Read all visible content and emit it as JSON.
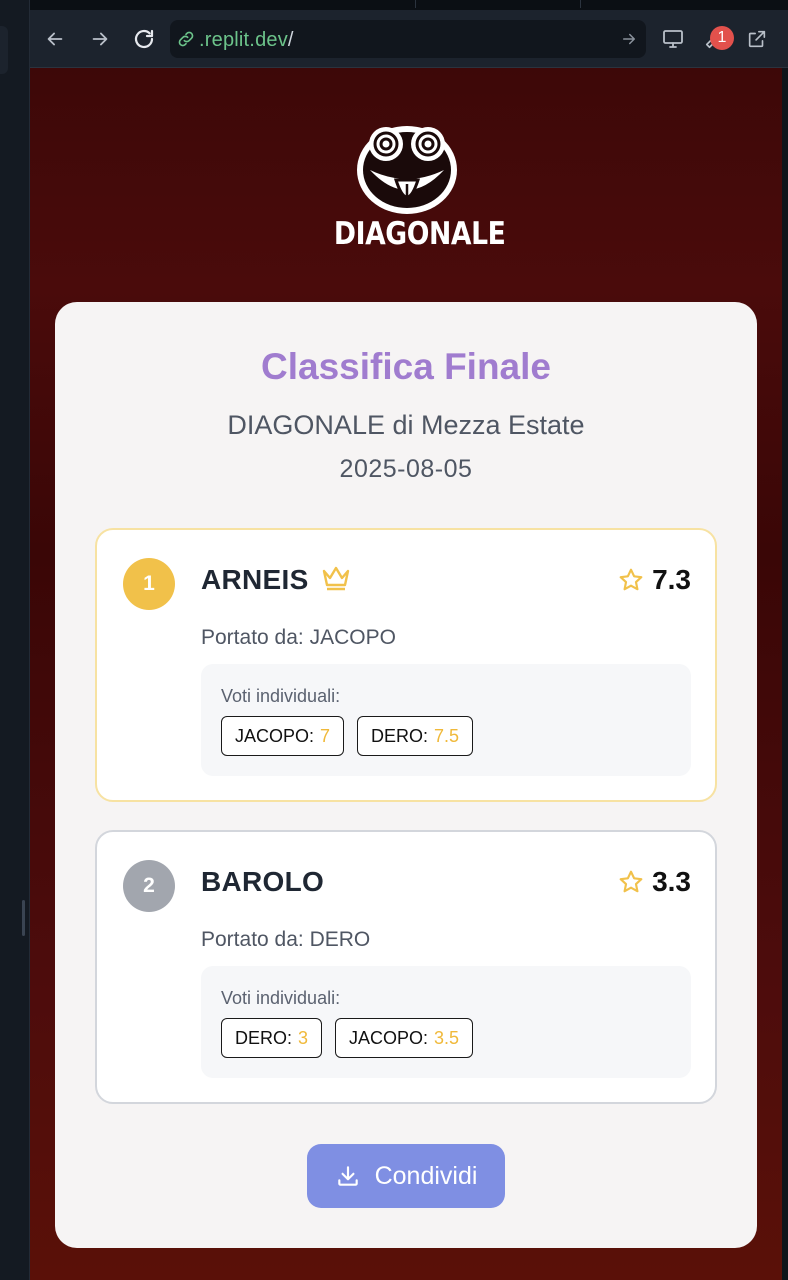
{
  "browser": {
    "url_host": ".replit.dev",
    "url_path": "/",
    "notification_count": "1"
  },
  "brand": {
    "name": "DIAGONALE"
  },
  "results": {
    "title": "Classifica Finale",
    "event_name": "DIAGONALE di Mezza Estate",
    "date": "2025-08-05",
    "votes_label": "Voti individuali:",
    "brought_prefix": "Portato da:",
    "ranking": [
      {
        "position": "1",
        "wine": "ARNEIS",
        "score": "7.3",
        "brought_by": "JACOPO",
        "votes": [
          {
            "name": "JACOPO:",
            "value": "7"
          },
          {
            "name": "DERO:",
            "value": "7.5"
          }
        ]
      },
      {
        "position": "2",
        "wine": "BAROLO",
        "score": "3.3",
        "brought_by": "DERO",
        "votes": [
          {
            "name": "DERO:",
            "value": "3"
          },
          {
            "name": "JACOPO:",
            "value": "3.5"
          }
        ]
      }
    ],
    "share_label": "Condividi"
  },
  "colors": {
    "title": "#a07ccf",
    "gold": "#f1c14a",
    "silver": "#a2a6ae",
    "share_button": "#7f8fe3",
    "background": "#4a0b0b"
  },
  "icons": [
    "back-arrow-icon",
    "forward-arrow-icon",
    "reload-icon",
    "link-icon",
    "go-arrow-icon",
    "monitor-icon",
    "wrench-icon",
    "external-link-icon",
    "crown-icon",
    "star-icon",
    "download-icon"
  ]
}
